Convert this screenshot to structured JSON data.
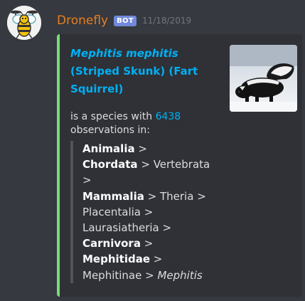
{
  "author": {
    "name": "Dronefly",
    "bot_tag": "BOT",
    "timestamp": "11/18/2019",
    "avatar_icon": "dronefly-bee-avatar"
  },
  "embed": {
    "accent_color": "#77dd77",
    "title_scientific": "Mephitis mephitis",
    "title_common": "(Striped Skunk) (Fart Squirrel)",
    "desc_before": "is a species with ",
    "observations": "6438",
    "desc_after": "observations in:",
    "thumbnail_icon": "striped-skunk-photo",
    "taxonomy": {
      "t1": "Animalia",
      "t2": "Chordata",
      "t3": "Vertebrata",
      "t4": "Mammalia",
      "t5": "Theria",
      "t6": "Placentalia",
      "t7": "Laurasiatheria",
      "t8": "Carnivora",
      "t9": "Mephitidae",
      "t10": "Mephitinae",
      "t11": "Mephitis"
    },
    "separator": ">"
  }
}
